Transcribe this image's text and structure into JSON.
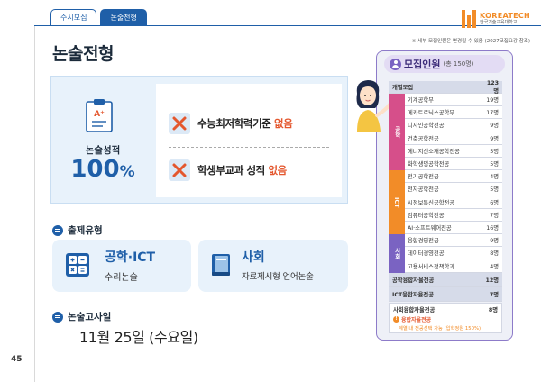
{
  "header": {
    "tabs": [
      {
        "label": "수시모집",
        "active": false
      },
      {
        "label": "논술전형",
        "active": true
      }
    ],
    "logo": {
      "name_en": "KOREATECH",
      "name_ko": "한국기술교육대학교"
    },
    "note": "※ 세부 모집인원은 변경될 수 있음 (2027모집요강 참조)"
  },
  "page_title": "논술전형",
  "page_number": "45",
  "essay_box": {
    "grade_icon_text": "A⁺",
    "score_label": "논술성적",
    "score_value": "100",
    "score_unit": "%",
    "items": [
      {
        "text": "수능최저학력기준 ",
        "highlight": "없음"
      },
      {
        "text": "학생부교과 성적 ",
        "highlight": "없음"
      }
    ]
  },
  "question_type": {
    "heading": "출제유형",
    "types": [
      {
        "title": "공학·ICT",
        "subtitle": "수리논술",
        "icon": "calculator-icon"
      },
      {
        "title": "사회",
        "subtitle": "자료제시형 언어논술",
        "icon": "book-icon"
      }
    ]
  },
  "exam": {
    "heading": "논술고사일",
    "date": "11월 25일 (수요일)"
  },
  "recruitment": {
    "title": "모집인원",
    "total": "(총 150명)",
    "header": {
      "name": "개별모집",
      "count": "123명"
    },
    "groups": [
      {
        "label": "공학",
        "rows": [
          {
            "name": "기계공학부",
            "count": "19명"
          },
          {
            "name": "메카트로닉스공학부",
            "count": "17명"
          },
          {
            "name": "디자인공학전공",
            "count": "9명"
          },
          {
            "name": "건축공학전공",
            "count": "9명"
          },
          {
            "name": "에너지신소재공학전공",
            "count": "5명"
          },
          {
            "name": "화학생명공학전공",
            "count": "5명"
          }
        ]
      },
      {
        "label": "ICT",
        "rows": [
          {
            "name": "전기공학전공",
            "count": "4명"
          },
          {
            "name": "전자공학전공",
            "count": "5명"
          },
          {
            "name": "시정보통신공학전공",
            "count": "6명"
          },
          {
            "name": "컴퓨터공학전공",
            "count": "7명"
          },
          {
            "name": "AI·소프트웨어전공",
            "count": "16명"
          }
        ]
      },
      {
        "label": "사회",
        "rows": [
          {
            "name": "융합경영전공",
            "count": "9명"
          },
          {
            "name": "데이터경영전공",
            "count": "8명"
          },
          {
            "name": "고용서비스정책학과",
            "count": "4명"
          }
        ]
      }
    ],
    "summary": [
      {
        "name": "공학융합자율전공",
        "count": "12명"
      },
      {
        "name": "ICT융합자율전공",
        "count": "7명"
      }
    ],
    "extra": {
      "name": "사회융합자율전공",
      "count": "8명",
      "sub_label": "융합자율전공",
      "note": "계열 내 전공선택 가능 (입학정원 150%)"
    }
  },
  "colors": {
    "primary": "#1f5fa8",
    "accent_red": "#e4572e",
    "orange": "#f28c28",
    "pink": "#d64f8a",
    "purple": "#7a63c2"
  }
}
